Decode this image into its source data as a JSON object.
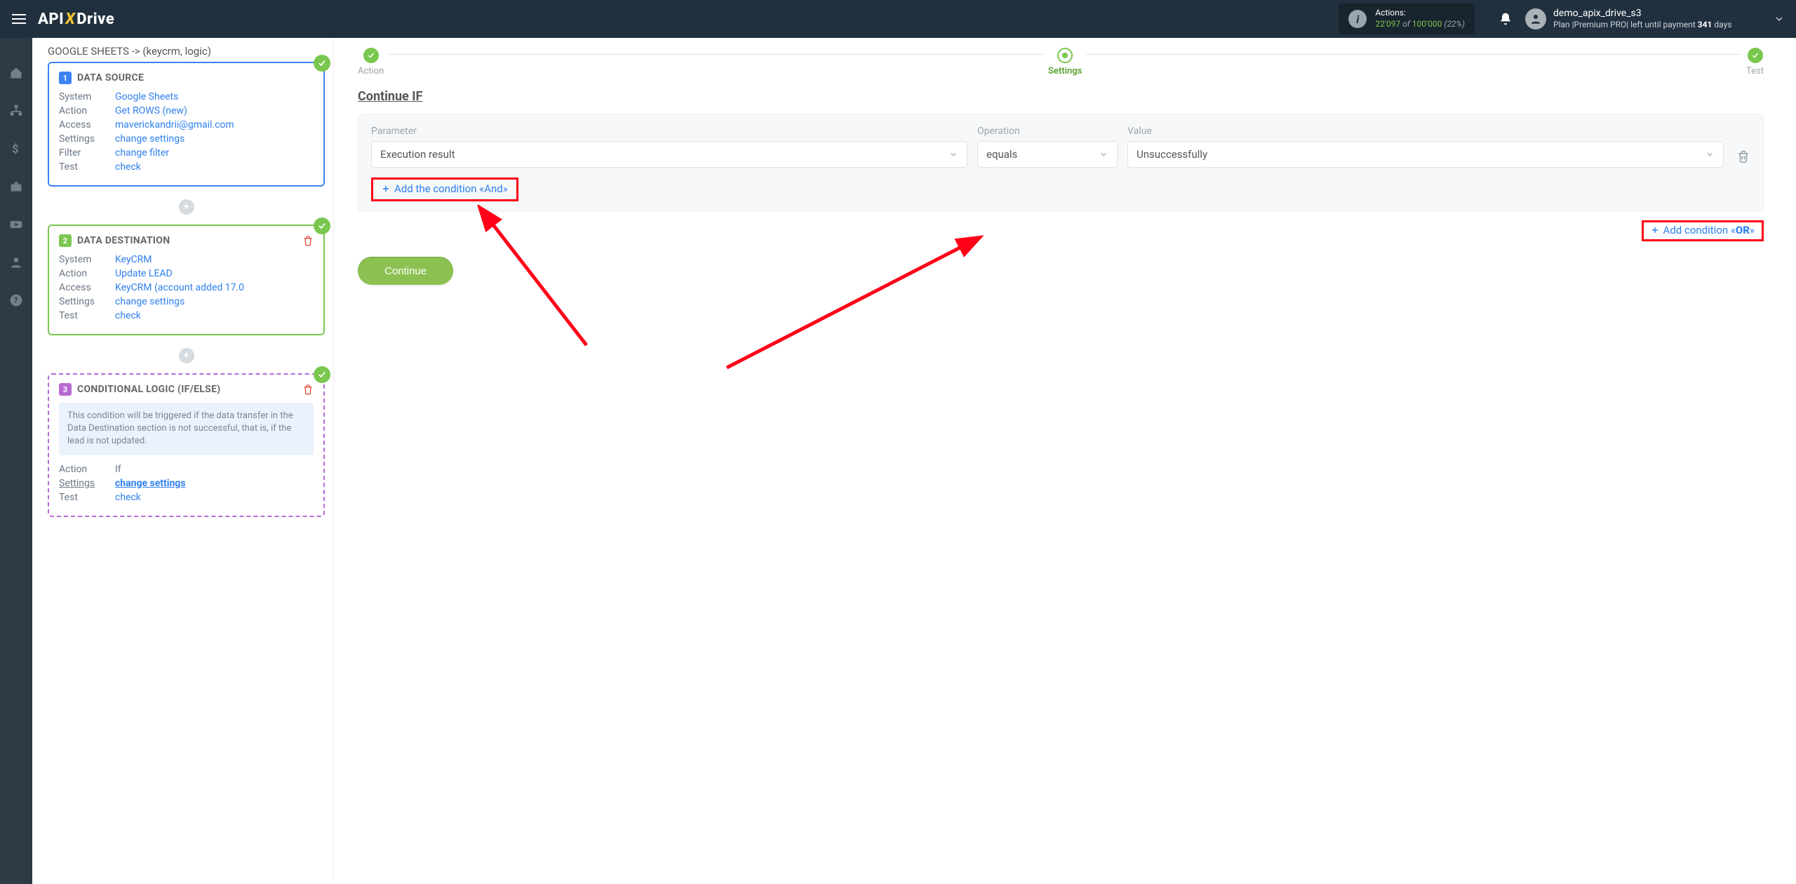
{
  "topbar": {
    "logo_pre": "API",
    "logo_x": "X",
    "logo_post": "Drive",
    "actions_label": "Actions:",
    "actions_count": "22'097",
    "actions_of": "of",
    "actions_total": "100'000",
    "actions_pct": "(22%)",
    "user_name": "demo_apix_drive_s3",
    "plan_prefix": "Plan |Premium PRO| left until payment ",
    "plan_days": "341",
    "plan_suffix": " days"
  },
  "breadcrumb": "GOOGLE SHEETS -> (keycrm, logic)",
  "card1": {
    "title": "DATA SOURCE",
    "rows": {
      "system_k": "System",
      "system_v": "Google Sheets",
      "action_k": "Action",
      "action_v": "Get ROWS (new)",
      "access_k": "Access",
      "access_v": "maverickandrii@gmail.com",
      "settings_k": "Settings",
      "settings_v": "change settings",
      "filter_k": "Filter",
      "filter_v": "change filter",
      "test_k": "Test",
      "test_v": "check"
    }
  },
  "card2": {
    "title": "DATA DESTINATION",
    "rows": {
      "system_k": "System",
      "system_v": "KeyCRM",
      "action_k": "Action",
      "action_v": "Update LEAD",
      "access_k": "Access",
      "access_v": "KeyCRM (account added 17.0",
      "settings_k": "Settings",
      "settings_v": "change settings",
      "test_k": "Test",
      "test_v": "check"
    }
  },
  "card3": {
    "title": "CONDITIONAL LOGIC (IF/ELSE)",
    "desc": "This condition will be triggered if the data transfer in the Data Destination section is not successful, that is, if the lead is not updated.",
    "rows": {
      "action_k": "Action",
      "action_v": "If",
      "settings_k": "Settings",
      "settings_v": "change settings",
      "test_k": "Test",
      "test_v": "check"
    }
  },
  "steps": {
    "action": "Action",
    "settings": "Settings",
    "test": "Test"
  },
  "section_title": "Continue IF",
  "cond": {
    "param_label": "Parameter",
    "op_label": "Operation",
    "val_label": "Value",
    "param_value": "Execution result",
    "op_value": "equals",
    "val_value": "Unsuccessfully",
    "add_and": "Add the condition «And»",
    "add_or_pre": "Add condition «",
    "add_or_bold": "OR",
    "add_or_post": "»"
  },
  "continue_btn": "Continue"
}
